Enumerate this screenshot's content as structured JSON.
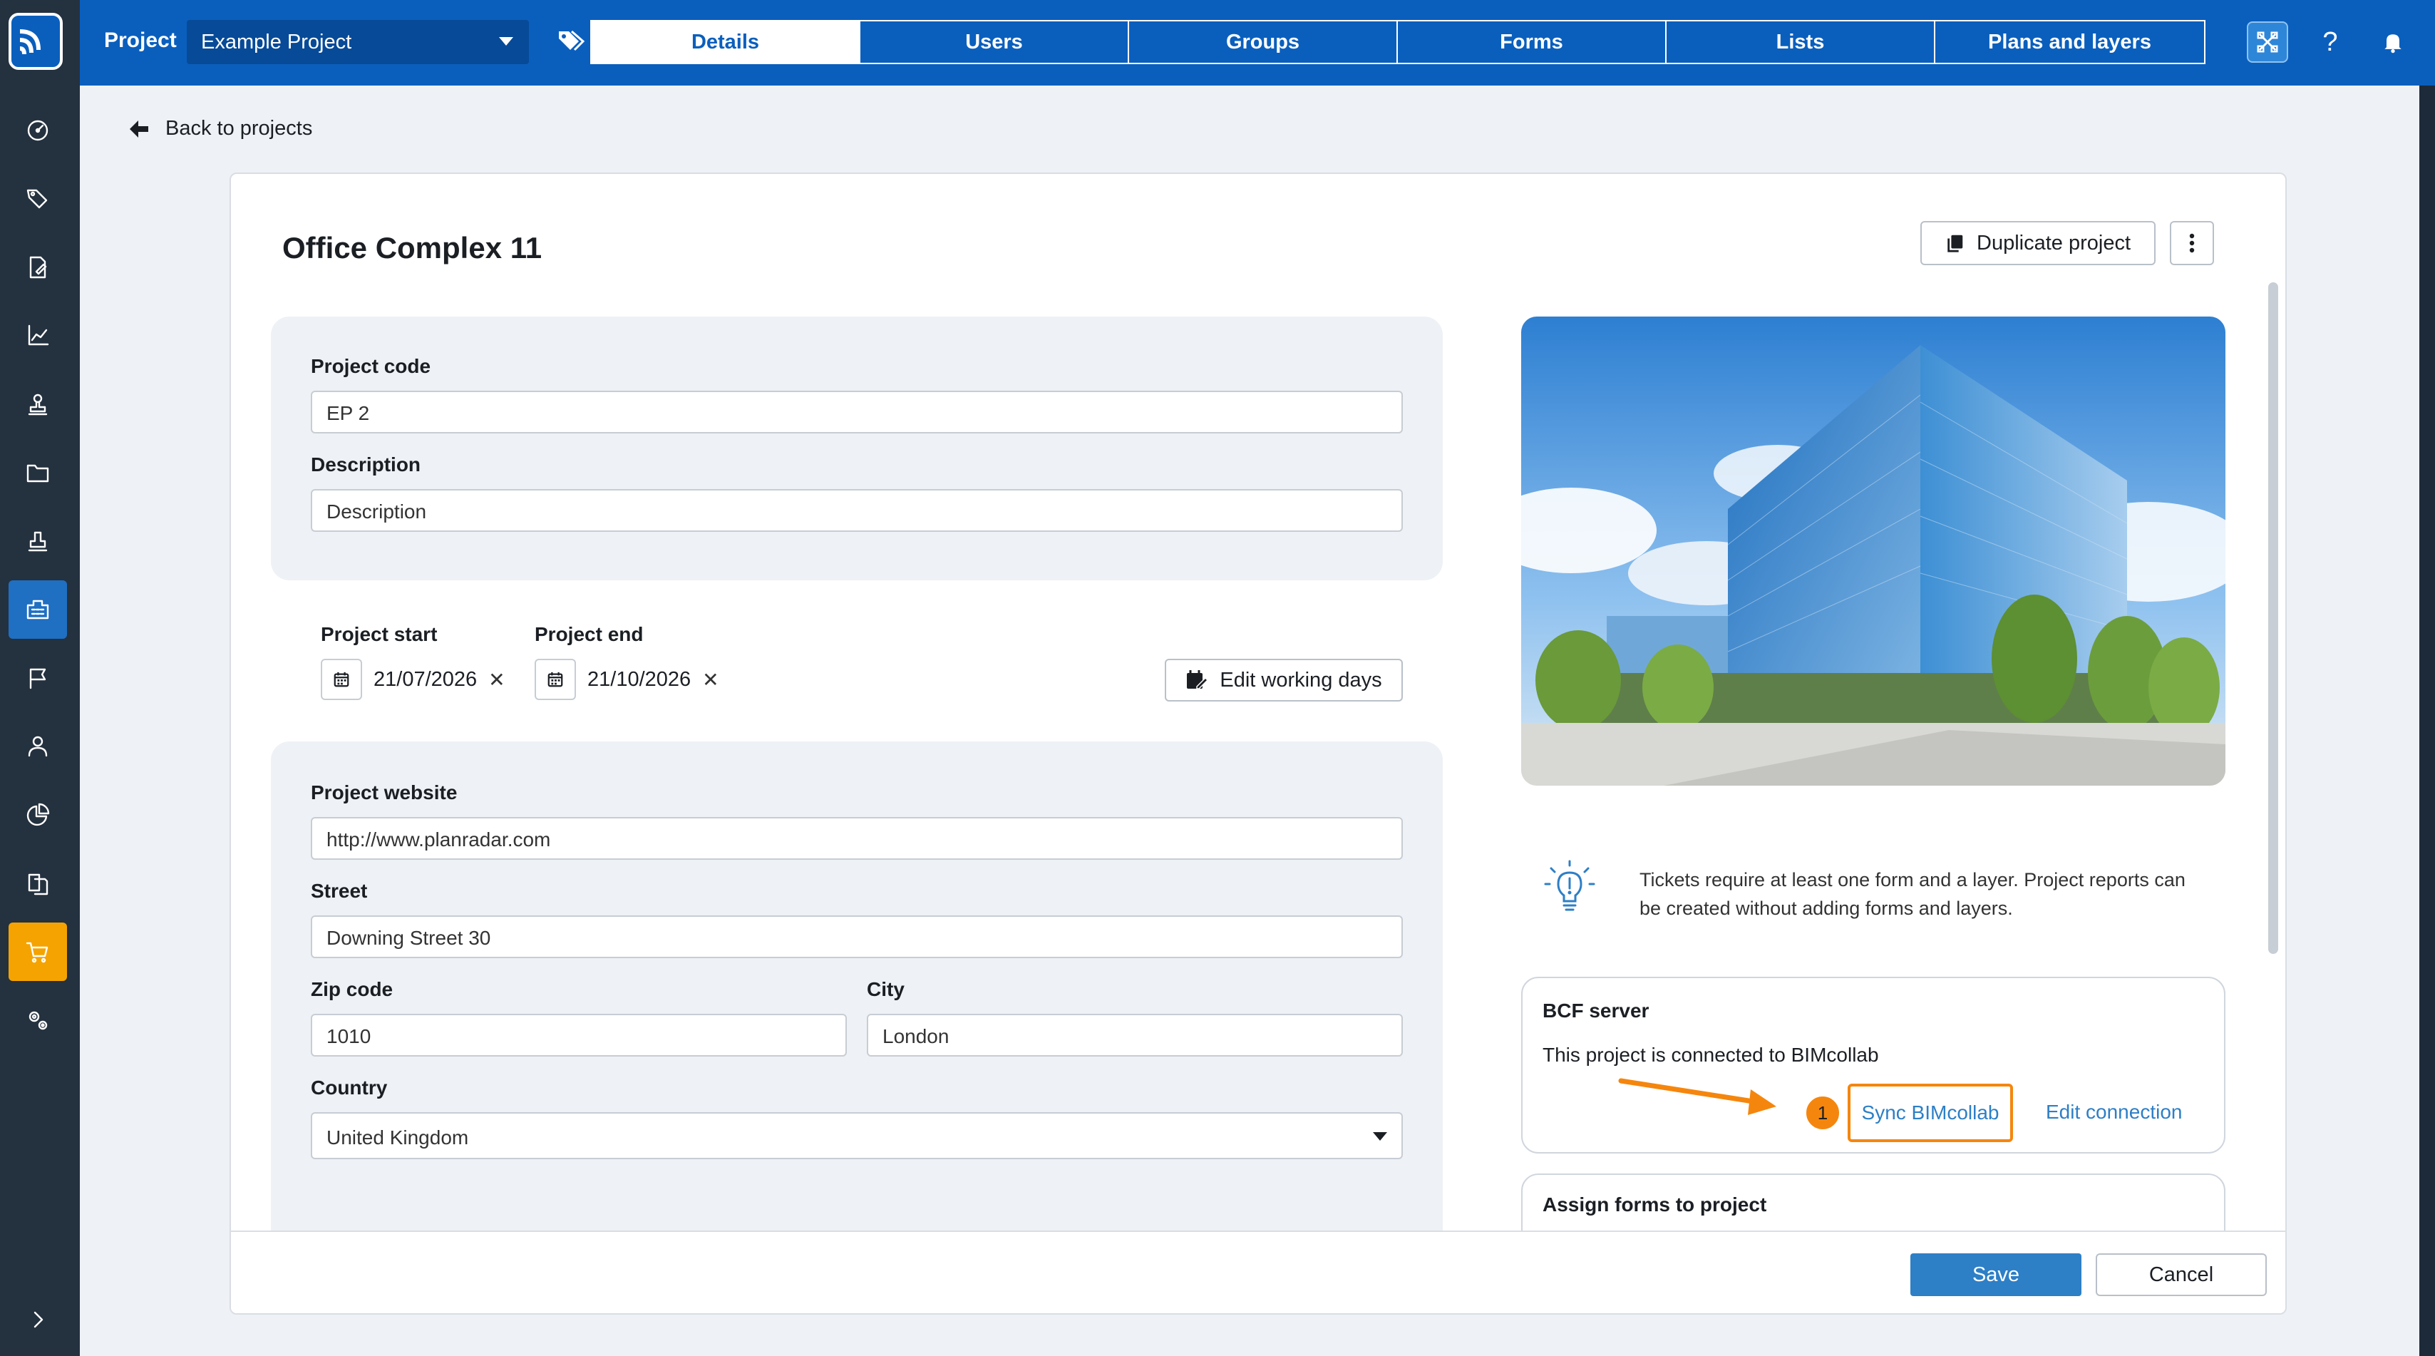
{
  "topbar": {
    "project_label": "Project",
    "project_select": "Example Project",
    "tabs": [
      {
        "label": "Details"
      },
      {
        "label": "Users"
      },
      {
        "label": "Groups"
      },
      {
        "label": "Forms"
      },
      {
        "label": "Lists"
      },
      {
        "label": "Plans and layers"
      }
    ],
    "help": "?"
  },
  "sidebar": {
    "items": [
      "dashboard",
      "tickets",
      "reports",
      "statistics",
      "stamps",
      "documents",
      "approvals",
      "projects",
      "flags",
      "users",
      "analytics",
      "files",
      "shop",
      "settings"
    ],
    "active": "projects",
    "expand": "chevron-right"
  },
  "back": {
    "label": "Back to projects"
  },
  "project": {
    "title": "Office Complex 11",
    "duplicate_label": "Duplicate project",
    "code_label": "Project code",
    "code_value": "EP 2",
    "description_label": "Description",
    "description_value": "Description",
    "start_label": "Project start",
    "start_value": "21/07/2026",
    "end_label": "Project end",
    "end_value": "21/10/2026",
    "working_days_label": "Edit working days",
    "website_label": "Project website",
    "website_value": "http://www.planradar.com",
    "street_label": "Street",
    "street_value": "Downing Street 30",
    "zip_label": "Zip code",
    "zip_value": "1010",
    "city_label": "City",
    "city_value": "London",
    "country_label": "Country",
    "country_value": "United Kingdom"
  },
  "hint": {
    "text": "Tickets require at least one form and a layer. Project reports can be created without adding forms and layers."
  },
  "bcf": {
    "title": "BCF server",
    "status": "This project is connected to BIMcollab",
    "step": "1",
    "sync_label": "Sync BIMcollab",
    "edit_label": "Edit connection"
  },
  "forms": {
    "title": "Assign forms to project"
  },
  "footer": {
    "save_label": "Save",
    "cancel_label": "Cancel"
  },
  "colors": {
    "brand": "#0a5fbd",
    "accent": "#2d7fc6",
    "highlight": "#f5860d",
    "shop": "#f5a300"
  }
}
